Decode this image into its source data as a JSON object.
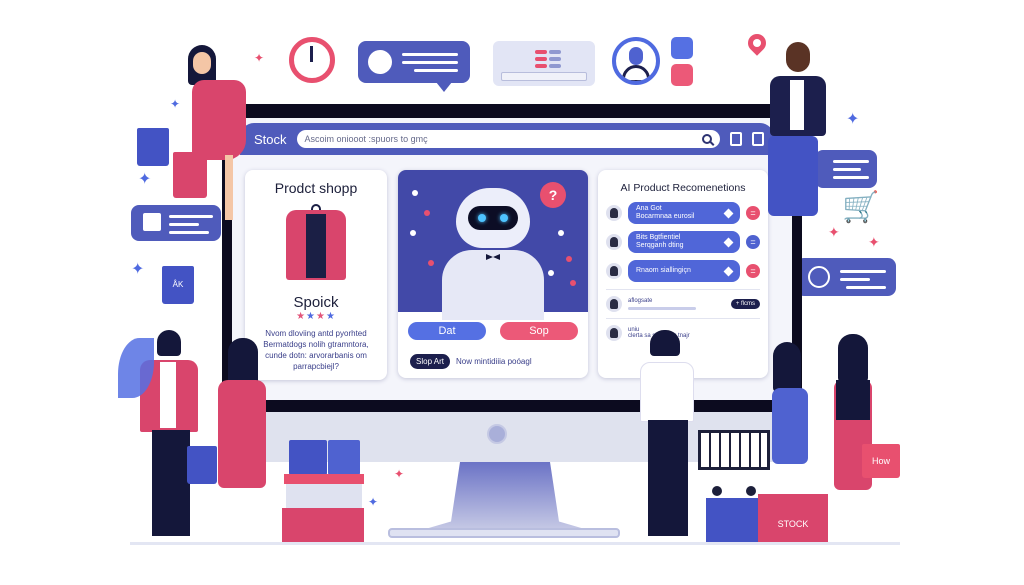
{
  "header": {
    "brand": "Stock",
    "search_placeholder": "Ascoim oniooot :spuors to gmç",
    "icons": [
      "search-icon",
      "account-icon",
      "tablet-icon"
    ]
  },
  "product_card": {
    "title": "Prodct shopp",
    "product_name": "Spoick",
    "rating_stars": 4,
    "description": "Nvom dloviing antd pyorhted Bermatdogs nolih gtramntora, cunde dotn: arvorarbanis om parrapcbiejl?"
  },
  "assistant_card": {
    "question_icon": "?",
    "button_primary": "Dat",
    "button_secondary": "Sop",
    "tag": "Slop Art",
    "caption": "Now mintidiiia poóagl"
  },
  "recommendations": {
    "title": "AI Product Recomenetions",
    "items": [
      {
        "line1": "Ana Got",
        "line2": "Bocarmnaa eurosil",
        "action": "pink"
      },
      {
        "line1": "Bits Bgtfientiel",
        "line2": "Serqganh dting",
        "action": "blue"
      },
      {
        "line1": "Rnaom siallingiçn",
        "line2": "",
        "action": "pink"
      }
    ],
    "mini": [
      {
        "label": "aflogsate",
        "badge": "+ flcms"
      },
      {
        "label": "uniu",
        "sub": "clerta   sa sbur ylox tnajr"
      }
    ]
  },
  "decor": {
    "bag_labels": {
      "left_bag": "ÅK",
      "right_bag": "How",
      "box": "STOCK"
    },
    "colors": {
      "primary": "#4f5bbb",
      "accent": "#e8506f",
      "dark": "#0c0b1f",
      "light": "#f4f5fb"
    }
  }
}
